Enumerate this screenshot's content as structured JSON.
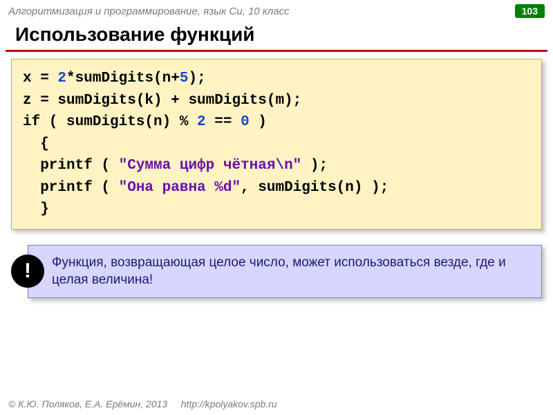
{
  "header": {
    "breadcrumb": "Алгоритмизация и программирование, язык Си, 10 класс",
    "page_number": "103"
  },
  "title": "Использование функций",
  "code": {
    "l1_a": "x = ",
    "l1_b": "2",
    "l1_c": "*sumDigits(n+",
    "l1_d": "5",
    "l1_e": ");",
    "l2": "z = sumDigits(k) + sumDigits(m);",
    "l3_a": "if ( sumDigits(n) % ",
    "l3_b": "2",
    "l3_c": " == ",
    "l3_d": "0",
    "l3_e": " )",
    "l4": "{",
    "l5_a": "printf ( ",
    "l5_b": "\"Сумма цифр чётная\\n\"",
    "l5_c": " );",
    "l6_a": "printf ( ",
    "l6_b": "\"Она равна %d\"",
    "l6_c": ", sumDigits(n) );",
    "l7": "}"
  },
  "note": {
    "badge": "!",
    "text": "Функция, возвращающая целое число, может использоваться везде, где и целая величина!"
  },
  "footer": {
    "copyright": "© К.Ю. Поляков, Е.А. Ерёмин, 2013",
    "url": "http://kpolyakov.spb.ru"
  }
}
